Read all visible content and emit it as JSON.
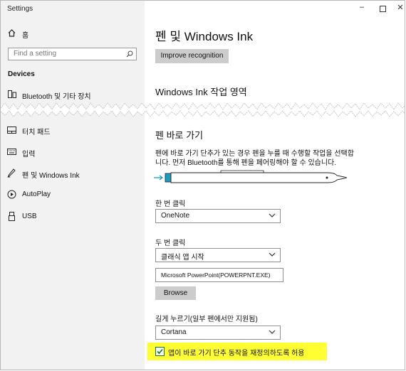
{
  "window": {
    "title": "Settings"
  },
  "sidebar": {
    "home": "홈",
    "search_placeholder": "Find a setting",
    "section": "Devices",
    "items": [
      {
        "label": "Bluetooth 및 기타 장치",
        "icon": "bluetooth-device-icon"
      },
      {
        "label": "터치 패드",
        "icon": "touchpad-icon"
      },
      {
        "label": "입력",
        "icon": "keyboard-icon"
      },
      {
        "label": "펜 및 Windows Ink",
        "icon": "pen-icon"
      },
      {
        "label": "AutoPlay",
        "icon": "autoplay-icon"
      },
      {
        "label": "USB",
        "icon": "usb-icon"
      }
    ]
  },
  "main": {
    "title": "펜 및 Windows Ink",
    "improve_button": "Improve recognition",
    "workspace_heading": "Windows Ink 작업 영역",
    "shortcut_heading": "펜 바로 가기",
    "shortcut_desc_line1": "펜에 바로 가기 단추가 있는 경우 펜을 누를 때 수행할 작업을 선택합",
    "shortcut_desc_line2": "니다. 먼저 Bluetooth를 통해 펜을 페어링해야 할 수 있습니다.",
    "single_click": {
      "label": "한 번 클릭",
      "value": "OneNote"
    },
    "double_click": {
      "label": "두 번 클릭",
      "value": "클래식 앱 시작",
      "path": "Microsoft PowerPoint(POWERPNT.EXE)",
      "browse": "Browse"
    },
    "press_hold": {
      "label": "길게 누르기(일부 펜에서만 지원됨)",
      "value": "Cortana"
    },
    "override_checkbox": {
      "label": "앱이 바로 가기 단추 동작을 재정의하도록 허용",
      "checked": true,
      "highlight": "#ffff33",
      "check_color": "#107c10"
    }
  }
}
